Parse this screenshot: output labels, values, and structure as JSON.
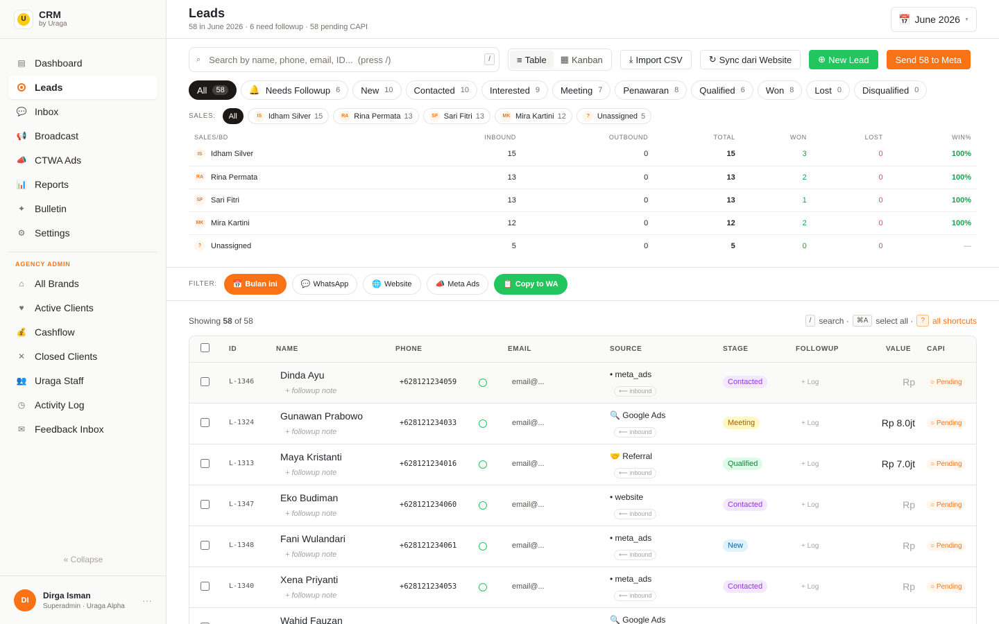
{
  "sidebar": {
    "brand": {
      "title": "CRM",
      "subtitle": "by Uraga"
    },
    "nav": [
      {
        "label": "Dashboard",
        "icon": "▤"
      },
      {
        "label": "Leads",
        "icon": ""
      },
      {
        "label": "Inbox",
        "icon": "💬"
      },
      {
        "label": "Broadcast",
        "icon": "📢"
      },
      {
        "label": "CTWA Ads",
        "icon": "📣"
      },
      {
        "label": "Reports",
        "icon": "📊"
      },
      {
        "label": "Bulletin",
        "icon": "✦"
      },
      {
        "label": "Settings",
        "icon": "⚙"
      }
    ],
    "section_title": "AGENCY ADMIN",
    "admin_nav": [
      {
        "label": "All Brands",
        "icon": "⌂"
      },
      {
        "label": "Active Clients",
        "icon": "♥"
      },
      {
        "label": "Cashflow",
        "icon": "💰"
      },
      {
        "label": "Closed Clients",
        "icon": "✕"
      },
      {
        "label": "Uraga Staff",
        "icon": "👥"
      },
      {
        "label": "Activity Log",
        "icon": "◷"
      },
      {
        "label": "Feedback Inbox",
        "icon": "✉"
      }
    ],
    "collapse_label": "« Collapse",
    "user": {
      "initials": "DI",
      "name": "Dirga Isman",
      "role": "Superadmin · Uraga Alpha",
      "more": "···"
    }
  },
  "header": {
    "title": "Leads",
    "subtitle": "58 in June 2026 · 6 need followup · 58 pending CAPI",
    "month_icon": "📅",
    "month_label": "June 2026",
    "month_caret": "▼"
  },
  "toolbar": {
    "search_placeholder": "Search by name, phone, email, ID...  (press /)",
    "search_icon": "⌕",
    "search_kbd": "/",
    "view_table": "Table",
    "view_table_icon": "≡",
    "view_kanban": "Kanban",
    "view_kanban_icon": "▦",
    "import_icon": "⤓",
    "import_label": "Import CSV",
    "sync_icon": "↻",
    "sync_label": "Sync dari Website",
    "new_lead_icon": "⊕",
    "new_lead_label": "New Lead",
    "send_meta_label": "Send 58 to Meta"
  },
  "stages": [
    {
      "icon": "",
      "label": "All",
      "count": "58",
      "active": true
    },
    {
      "icon": "🔔",
      "label": "Needs Followup",
      "count": "6"
    },
    {
      "icon": "",
      "label": "New",
      "count": "10"
    },
    {
      "icon": "",
      "label": "Contacted",
      "count": "10"
    },
    {
      "icon": "",
      "label": "Interested",
      "count": "9"
    },
    {
      "icon": "",
      "label": "Meeting",
      "count": "7"
    },
    {
      "icon": "",
      "label": "Penawaran",
      "count": "8"
    },
    {
      "icon": "",
      "label": "Qualified",
      "count": "6"
    },
    {
      "icon": "",
      "label": "Won",
      "count": "8"
    },
    {
      "icon": "",
      "label": "Lost",
      "count": "0"
    },
    {
      "icon": "",
      "label": "Disqualified",
      "count": "0"
    }
  ],
  "sales_filter": {
    "label": "SALES:",
    "all_label": "All",
    "people": [
      {
        "initials": "IS",
        "name": "Idham Silver",
        "count": "15"
      },
      {
        "initials": "RA",
        "name": "Rina Permata",
        "count": "13"
      },
      {
        "initials": "SF",
        "name": "Sari Fitri",
        "count": "13"
      },
      {
        "initials": "MK",
        "name": "Mira Kartini",
        "count": "12"
      },
      {
        "initials": "?",
        "name": "Unassigned",
        "count": "5"
      }
    ]
  },
  "sales_table": {
    "headers": [
      "SALES/BD",
      "INBOUND",
      "OUTBOUND",
      "TOTAL",
      "WON",
      "LOST",
      "WIN%"
    ],
    "rows": [
      {
        "initials": "IS",
        "name": "Idham Silver",
        "inbound": "15",
        "outbound": "0",
        "total": "15",
        "won": "3",
        "lost": "0",
        "win": "100%"
      },
      {
        "initials": "RA",
        "name": "Rina Permata",
        "inbound": "13",
        "outbound": "0",
        "total": "13",
        "won": "2",
        "lost": "0",
        "win": "100%"
      },
      {
        "initials": "SF",
        "name": "Sari Fitri",
        "inbound": "13",
        "outbound": "0",
        "total": "13",
        "won": "1",
        "lost": "0",
        "win": "100%"
      },
      {
        "initials": "MK",
        "name": "Mira Kartini",
        "inbound": "12",
        "outbound": "0",
        "total": "12",
        "won": "2",
        "lost": "0",
        "win": "100%"
      },
      {
        "initials": "?",
        "name": "Unassigned",
        "inbound": "5",
        "outbound": "0",
        "total": "5",
        "won": "0",
        "lost": "0",
        "win": "—"
      }
    ]
  },
  "filters": {
    "label": "FILTER:",
    "items": [
      {
        "icon": "📅",
        "label": "Bulan ini",
        "style": "orange"
      },
      {
        "icon": "💬",
        "label": "WhatsApp",
        "style": ""
      },
      {
        "icon": "🌐",
        "label": "Website",
        "style": ""
      },
      {
        "icon": "📣",
        "label": "Meta Ads",
        "style": ""
      },
      {
        "icon": "📋",
        "label": "Copy to WA",
        "style": "green"
      }
    ]
  },
  "listing": {
    "showing_prefix": "Showing",
    "showing_count": "58",
    "showing_suffix": "of 58",
    "kbd_search": "/",
    "search_hint": "search ·",
    "kbd_select": "⌘A",
    "select_hint": "select all ·",
    "kbd_shortcuts": "?",
    "shortcuts_link": "all shortcuts"
  },
  "leads_table": {
    "headers": {
      "id": "ID",
      "name": "NAME",
      "phone": "PHONE",
      "email": "EMAIL",
      "source": "SOURCE",
      "stage": "STAGE",
      "followup": "FOLLOWUP",
      "value": "VALUE",
      "capi": "CAPI"
    },
    "note_placeholder": "+ followup note",
    "log_label": "+ Log",
    "direction_label": "⟵ inbound",
    "capi_label": "○ Pending",
    "rows": [
      {
        "id": "L-1346",
        "name": "Dinda Ayu",
        "phone": "+628121234059",
        "email": "email@...",
        "source": "• meta_ads",
        "stage": "Contacted",
        "stage_class": "st-contacted",
        "value": "Rp",
        "value_muted": true
      },
      {
        "id": "L-1324",
        "name": "Gunawan Prabowo",
        "phone": "+628121234033",
        "email": "email@...",
        "source": "🔍 Google Ads",
        "stage": "Meeting",
        "stage_class": "st-meeting",
        "value": "Rp 8.0jt",
        "value_muted": false
      },
      {
        "id": "L-1313",
        "name": "Maya Kristanti",
        "phone": "+628121234016",
        "email": "email@...",
        "source": "🤝 Referral",
        "stage": "Qualified",
        "stage_class": "st-qualified",
        "value": "Rp 7.0jt",
        "value_muted": false
      },
      {
        "id": "L-1347",
        "name": "Eko Budiman",
        "phone": "+628121234060",
        "email": "email@...",
        "source": "• website",
        "stage": "Contacted",
        "stage_class": "st-contacted",
        "value": "Rp",
        "value_muted": true
      },
      {
        "id": "L-1348",
        "name": "Fani Wulandari",
        "phone": "+628121234061",
        "email": "email@...",
        "source": "• meta_ads",
        "stage": "New",
        "stage_class": "st-new",
        "value": "Rp",
        "value_muted": true
      },
      {
        "id": "L-1340",
        "name": "Xena Priyanti",
        "phone": "+628121234053",
        "email": "email@...",
        "source": "• meta_ads",
        "stage": "Contacted",
        "stage_class": "st-contacted",
        "value": "Rp",
        "value_muted": true
      },
      {
        "id": "",
        "name": "Wahid Fauzan",
        "phone": "",
        "email": "",
        "source": "🔍 Google Ads",
        "stage": "",
        "stage_class": "st-contacted",
        "value": "",
        "value_muted": true
      }
    ]
  },
  "colors": {
    "accent": "#f97316",
    "success": "#22c55e",
    "danger": "#ef4444"
  }
}
